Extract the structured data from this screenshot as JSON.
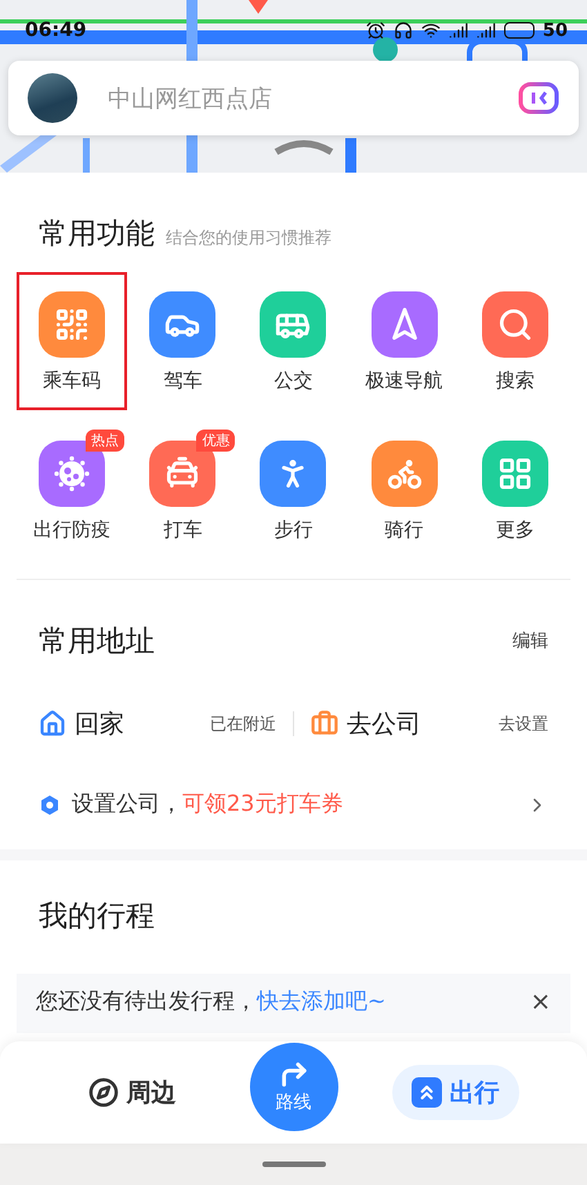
{
  "status_bar": {
    "time": "06:49",
    "battery": "50"
  },
  "search": {
    "placeholder": "中山网红西点店"
  },
  "features": {
    "title": "常用功能",
    "subtitle": "结合您的使用习惯推荐",
    "items": [
      {
        "label": "乘车码",
        "kind": "qr",
        "color": "#ff8a3d",
        "highlighted": true
      },
      {
        "label": "驾车",
        "kind": "car",
        "color": "#3f8cff",
        "highlighted": false
      },
      {
        "label": "公交",
        "kind": "bus",
        "color": "#1fcf9a",
        "highlighted": false
      },
      {
        "label": "极速导航",
        "kind": "navigate",
        "color": "#a86bff",
        "highlighted": false
      },
      {
        "label": "搜索",
        "kind": "search",
        "color": "#ff6a55",
        "highlighted": false
      },
      {
        "label": "出行防疫",
        "kind": "virus",
        "color": "#a86bff",
        "highlighted": false,
        "badge": "热点"
      },
      {
        "label": "打车",
        "kind": "taxi",
        "color": "#ff6a55",
        "highlighted": false,
        "badge": "优惠"
      },
      {
        "label": "步行",
        "kind": "walk",
        "color": "#3f8cff",
        "highlighted": false
      },
      {
        "label": "骑行",
        "kind": "bike",
        "color": "#ff8a3d",
        "highlighted": false
      },
      {
        "label": "更多",
        "kind": "more",
        "color": "#1fcf9a",
        "highlighted": false
      }
    ]
  },
  "addresses": {
    "title": "常用地址",
    "action": "编辑",
    "places": [
      {
        "kind": "home",
        "name": "回家",
        "note": "已在附近"
      },
      {
        "kind": "work",
        "name": "去公司",
        "note": "去设置"
      }
    ],
    "promo": {
      "text": "设置公司，",
      "highlight": "可领23元打车券"
    }
  },
  "trips": {
    "title": "我的行程",
    "notice": {
      "text": "您还没有待出发行程，",
      "link": "快去添加吧~",
      "close": "×"
    }
  },
  "nav": [
    {
      "label": "周边",
      "kind": "nearby",
      "selected": false
    },
    {
      "label": "路线",
      "kind": "route",
      "selected": false
    },
    {
      "label": "出行",
      "kind": "travel",
      "selected": true
    }
  ]
}
